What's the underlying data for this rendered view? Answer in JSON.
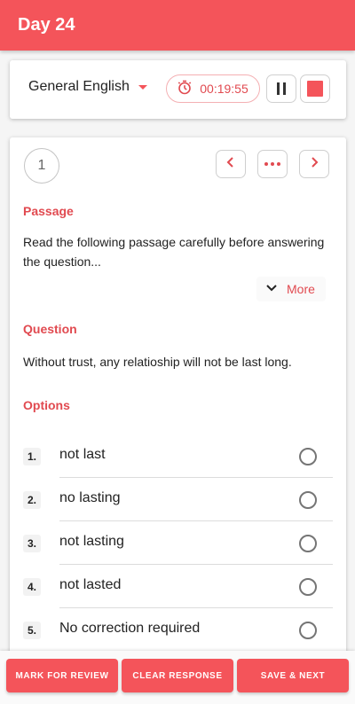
{
  "header": {
    "title": "Day 24"
  },
  "subject": {
    "selected": "General English",
    "timer": "00:19:55"
  },
  "question_card": {
    "number": "1",
    "passage_label": "Passage",
    "passage_text": "Read the following passage carefully before answering the question...",
    "more_label": "More",
    "question_label": "Question",
    "question_text": "Without trust, any relatioship will not be last long.",
    "options_label": "Options",
    "options": [
      {
        "num": "1.",
        "text": "not last"
      },
      {
        "num": "2.",
        "text": "no lasting"
      },
      {
        "num": "3.",
        "text": "not lasting"
      },
      {
        "num": "4.",
        "text": "not lasted"
      },
      {
        "num": "5.",
        "text": "No correction required"
      }
    ]
  },
  "actions": {
    "mark_for_review": "MARK FOR REVIEW",
    "clear_response": "CLEAR RESPONSE",
    "save_next": "SAVE & NEXT"
  },
  "colors": {
    "accent": "#f4545a",
    "accent_text": "#e14a50"
  },
  "icons": {
    "timer": "stopwatch-icon",
    "pause": "pause-icon",
    "stop": "stop-icon",
    "prev": "chevron-left-icon",
    "menu": "more-horizontal-icon",
    "next": "chevron-right-icon",
    "expand": "chevron-down-icon",
    "subject_dropdown": "caret-down-icon"
  }
}
